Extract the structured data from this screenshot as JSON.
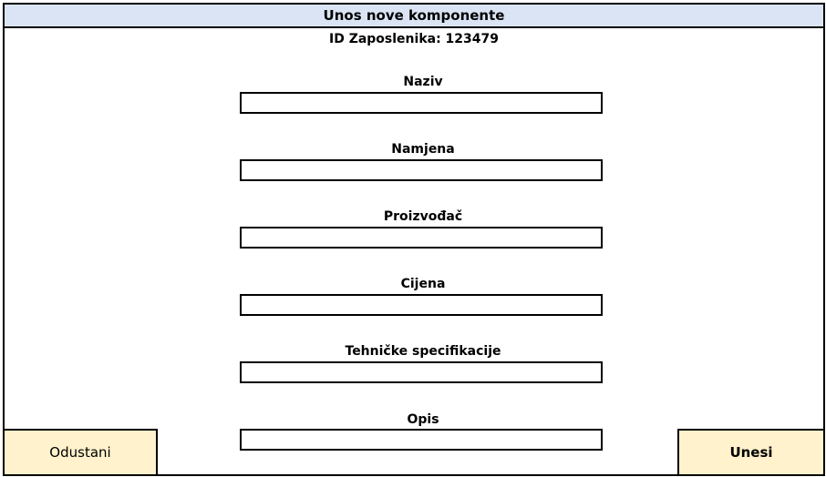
{
  "window": {
    "title": "Unos nove komponente"
  },
  "employee": {
    "id_text": "ID Zaposlenika: 123479"
  },
  "form": {
    "fields": [
      {
        "label": "Naziv",
        "value": ""
      },
      {
        "label": "Namjena",
        "value": ""
      },
      {
        "label": "Proizvođač",
        "value": ""
      },
      {
        "label": "Cijena",
        "value": ""
      },
      {
        "label": "Tehničke specifikacije",
        "value": ""
      },
      {
        "label": "Opis",
        "value": ""
      }
    ]
  },
  "actions": {
    "cancel_label": "Odustani",
    "submit_label": "Unesi"
  },
  "colors": {
    "titlebar": "#dbe4f4",
    "button": "#fff2cc"
  }
}
